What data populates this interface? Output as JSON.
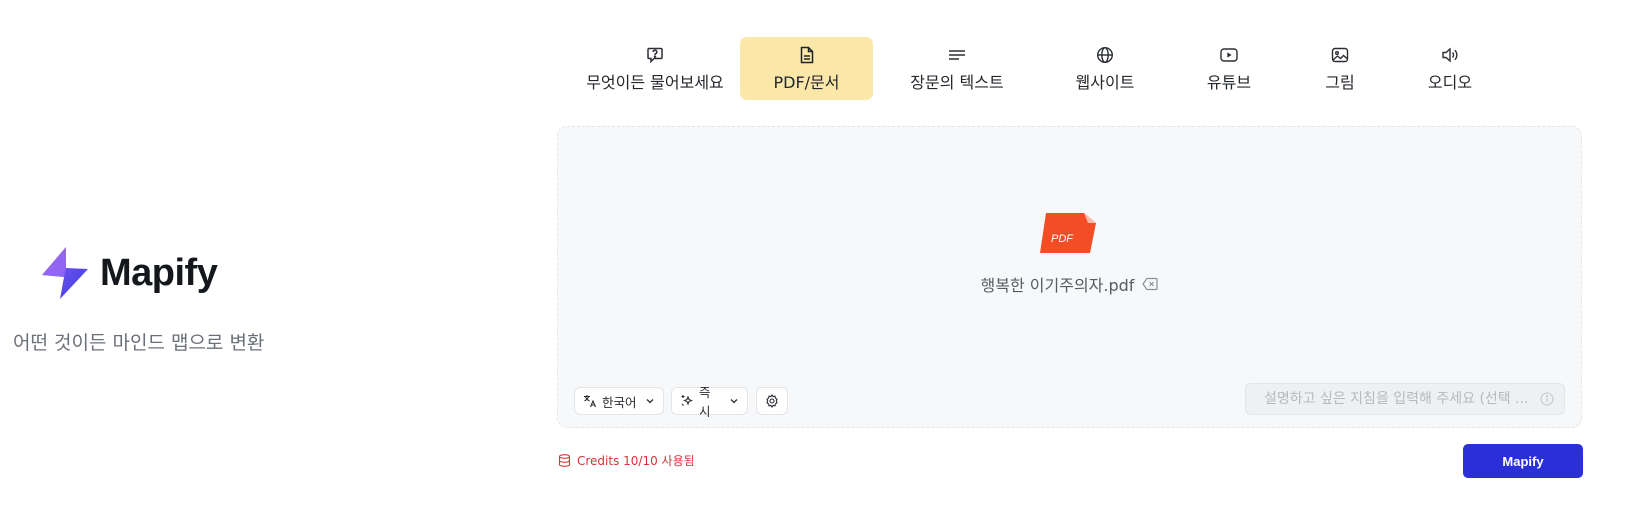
{
  "brand": {
    "name": "Mapify",
    "tagline": "어떤 것이든 마인드 맵으로 변환"
  },
  "tabs": [
    {
      "label": "무엇이든 물어보세요",
      "icon": "question-bubble-icon",
      "active": false
    },
    {
      "label": "PDF/문서",
      "icon": "document-icon",
      "active": true
    },
    {
      "label": "장문의 텍스트",
      "icon": "text-lines-icon",
      "active": false
    },
    {
      "label": "웹사이트",
      "icon": "globe-icon",
      "active": false
    },
    {
      "label": "유튜브",
      "icon": "youtube-icon",
      "active": false
    },
    {
      "label": "그림",
      "icon": "image-icon",
      "active": false
    },
    {
      "label": "오디오",
      "icon": "speaker-icon",
      "active": false
    }
  ],
  "upload": {
    "file_badge": "PDF",
    "file_name": "행복한 이기주의자.pdf"
  },
  "controls": {
    "language": "한국어",
    "mode": "즉시",
    "instructions_placeholder": "설명하고 싶은 지침을 입력해 주세요 (선택 ..."
  },
  "footer": {
    "credits": "Credits 10/10 사용됨",
    "submit_label": "Mapify"
  },
  "colors": {
    "active_tab": "#fbe7a8",
    "primary_button": "#2a2fd8",
    "credits_text": "#d6333a",
    "pdf_icon": "#f24d25"
  }
}
